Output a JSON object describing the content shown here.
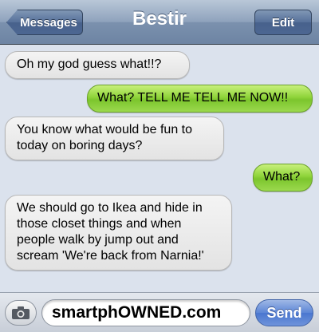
{
  "navbar": {
    "back_label": "Messages",
    "title": "Bestir",
    "edit_label": "Edit"
  },
  "messages": [
    {
      "direction": "incoming",
      "text": "Oh my god guess what!!?"
    },
    {
      "direction": "outgoing",
      "text": "What? TELL ME TELL ME NOW!!"
    },
    {
      "direction": "incoming",
      "text": "You know what would be fun to today on boring days?"
    },
    {
      "direction": "outgoing",
      "text": "What?"
    },
    {
      "direction": "incoming",
      "text": "We should go to Ikea and hide in those closet things and when people walk by jump out and scream 'We're back from Narnia!'"
    }
  ],
  "composer": {
    "camera_icon": "camera-icon",
    "input_value": "smartphOWNED.com",
    "send_label": "Send"
  },
  "colors": {
    "incoming_bubble": "#e6e6e6",
    "outgoing_bubble": "#8fd43a",
    "navbar": "#7b91ae",
    "send_button": "#5c85d6",
    "background": "#dbe2ed"
  }
}
